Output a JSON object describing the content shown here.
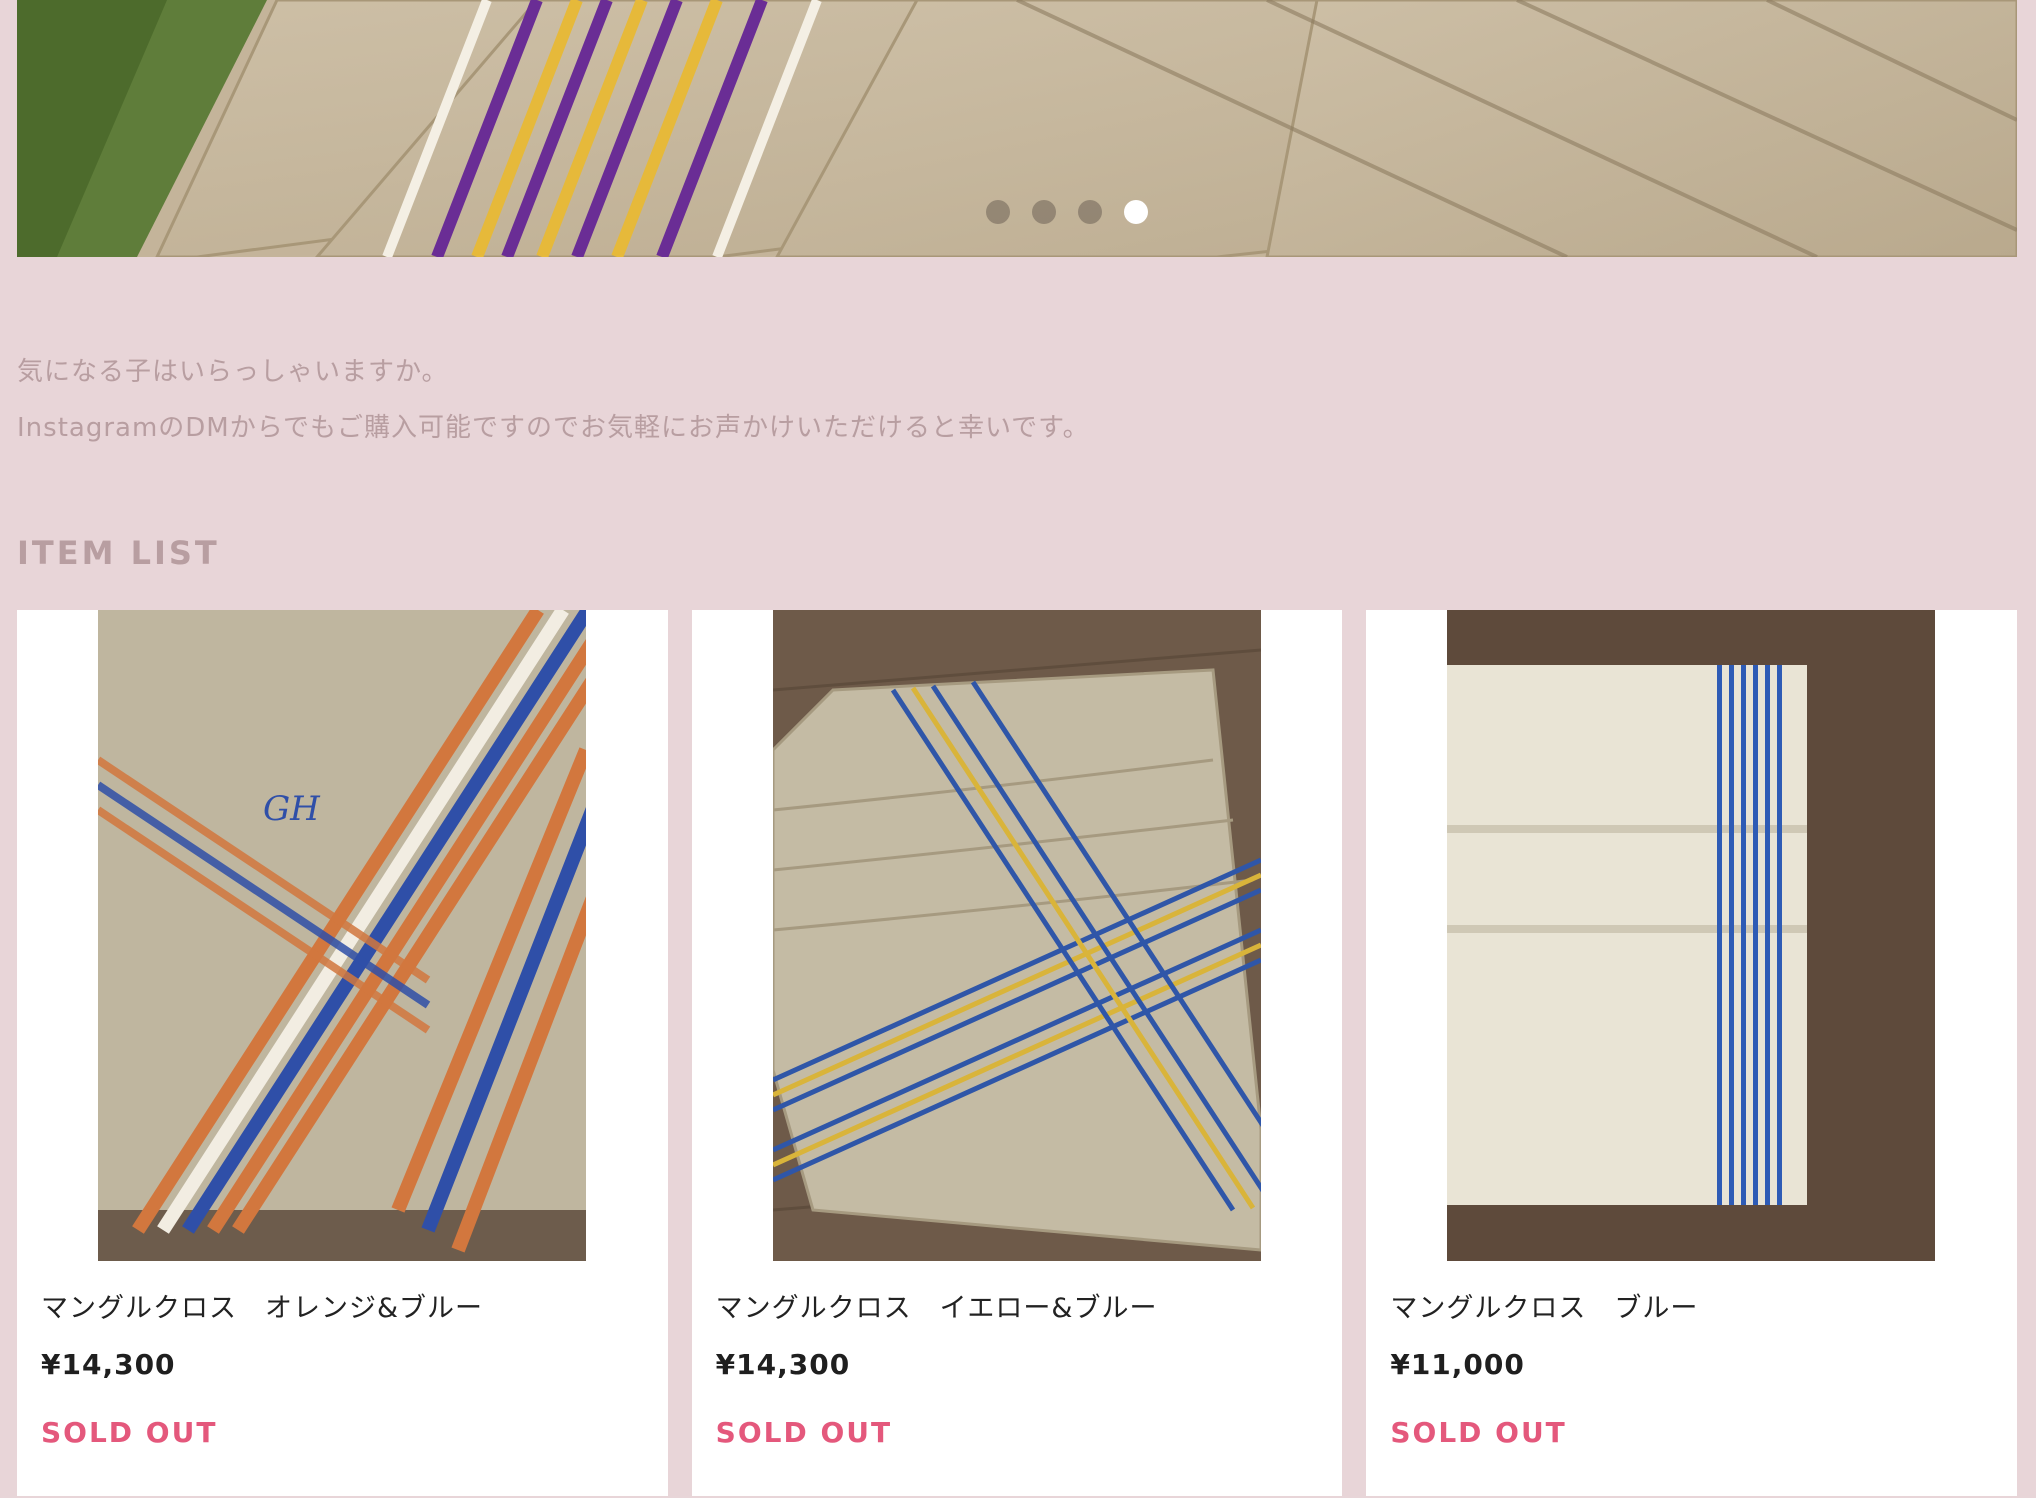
{
  "hero": {
    "slide_count": 4,
    "active_slide": 4,
    "image_icon": "striped-linen-cloth-photo"
  },
  "intro": {
    "line1": "気になる子はいらっしゃいますか。",
    "line2": "InstagramのDMからでもご購入可能ですのでお気軽にお声かけいただけると幸いです。"
  },
  "item_list": {
    "title": "ITEM LIST",
    "items": [
      {
        "name": "マングルクロス　オレンジ&ブルー",
        "price": "¥14,300",
        "status": "SOLD OUT",
        "stripe_colors": [
          "#d2773e",
          "#2f4fa8"
        ]
      },
      {
        "name": "マングルクロス　イエロー&ブルー",
        "price": "¥14,300",
        "status": "SOLD OUT",
        "stripe_colors": [
          "#d9b43a",
          "#2f56a8"
        ]
      },
      {
        "name": "マングルクロス　ブルー",
        "price": "¥11,000",
        "status": "SOLD OUT",
        "stripe_colors": [
          "#2e5bb5"
        ]
      }
    ]
  },
  "colors": {
    "background": "#e8d5d8",
    "muted_text": "#b89ea1",
    "sold_out": "#e4587c",
    "card": "#ffffff"
  }
}
